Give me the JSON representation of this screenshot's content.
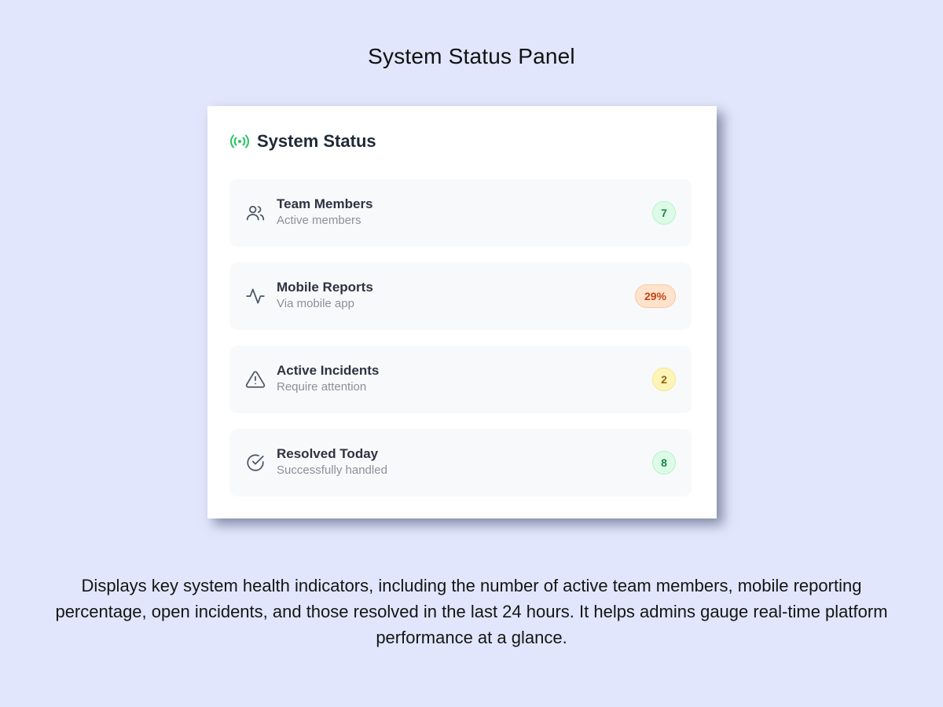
{
  "page": {
    "title": "System Status Panel",
    "description": "Displays key system health indicators, including the number of active team members, mobile reporting percentage, open incidents, and those resolved in the last 24 hours. It helps admins gauge real-time platform performance at a glance."
  },
  "panel": {
    "title": "System Status",
    "title_icon": "signal-broadcast-icon",
    "accent_color": "#22c55e",
    "rows": [
      {
        "label": "Team Members",
        "sublabel": "Active members",
        "value": "7",
        "icon": "users-icon",
        "status_color": "#23804a"
      },
      {
        "label": "Mobile Reports",
        "sublabel": "Via mobile app",
        "value": "29%",
        "icon": "activity-icon",
        "status_color": "#c4441a"
      },
      {
        "label": "Active Incidents",
        "sublabel": "Require attention",
        "value": "2",
        "icon": "alert-triangle-icon",
        "status_color": "#8a6513"
      },
      {
        "label": "Resolved Today",
        "sublabel": "Successfully handled",
        "value": "8",
        "icon": "check-circle-icon",
        "status_color": "#23804a"
      }
    ]
  }
}
